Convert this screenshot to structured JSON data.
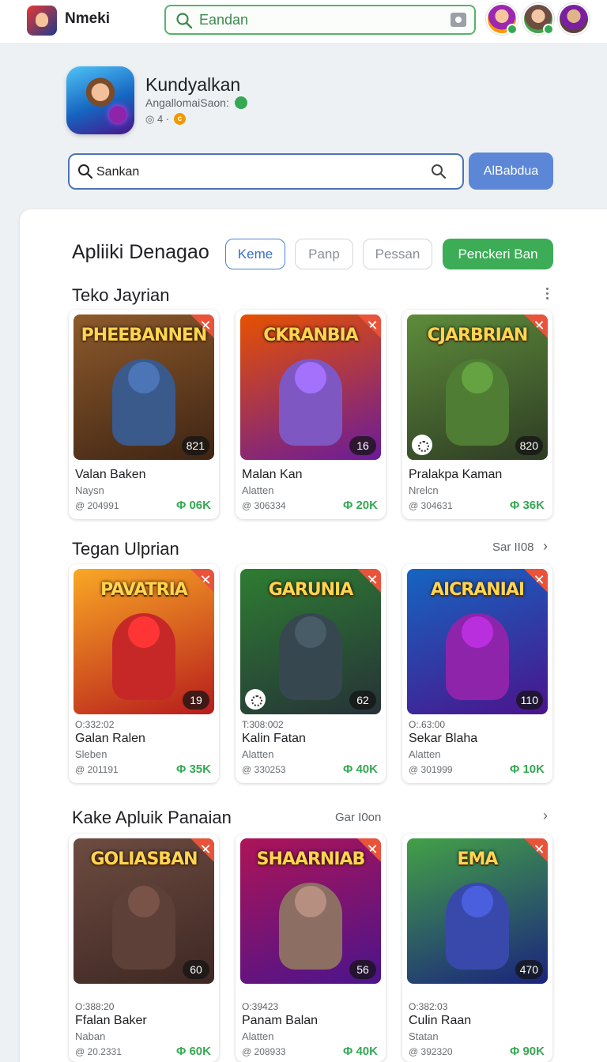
{
  "topbar": {
    "brand": "Nmeki",
    "search_value": "Eandan"
  },
  "app": {
    "name": "Kundyalkan",
    "developer": "AngallomaiSaon:",
    "meta": "4 ·"
  },
  "search": {
    "value": "Sankan",
    "button_label": "AlBabdua"
  },
  "main": {
    "title": "Apliiki Denagao",
    "chips": [
      "Keme",
      "Panp",
      "Pessan",
      "Penckeri Ban"
    ]
  },
  "sections": [
    {
      "title": "Teko Jayrian",
      "link": "",
      "cards": [
        {
          "art": "PHEEBANNEN",
          "name": "Valan Baken",
          "dev": "Naysn",
          "id": "@ 204991",
          "price": "06K",
          "count": "821",
          "ts": ""
        },
        {
          "art": "CKRANBIA",
          "name": "Malan Kan",
          "dev": "Alatten",
          "id": "@ 306334",
          "price": "20K",
          "count": "16",
          "ts": ""
        },
        {
          "art": "CJARBRIAN",
          "name": "Pralakpa Kaman",
          "dev": "Nrelcn",
          "id": "@ 304631",
          "price": "36K",
          "count": "820",
          "ts": ""
        }
      ]
    },
    {
      "title": "Tegan Ulprian",
      "link": "Sar II08",
      "cards": [
        {
          "art": "PAVATRIA",
          "name": "Galan Ralen",
          "dev": "Sleben",
          "id": "@ 201191",
          "price": "35K",
          "count": "19",
          "ts": "O:332:02"
        },
        {
          "art": "GARUNIA",
          "name": "Kalin Fatan",
          "dev": "Alatten",
          "id": "@ 330253",
          "price": "40K",
          "count": "62",
          "ts": "T:308:002"
        },
        {
          "art": "AICRANIAI",
          "name": "Sekar Blaha",
          "dev": "Alatten",
          "id": "@ 301999",
          "price": "10K",
          "count": "110",
          "ts": "O:.63:00"
        }
      ]
    },
    {
      "title": "Kake Apluik Panaian",
      "link": "Gar I0on",
      "cards": [
        {
          "art": "GOLIASBAN",
          "name": "Ffalan Baker",
          "dev": "Naban",
          "id": "@ 20.2331",
          "price": "60K",
          "count": "60",
          "ts": "O:388:20"
        },
        {
          "art": "SHAARNIAB",
          "name": "Panam Balan",
          "dev": "Alatten",
          "id": "@ 208933",
          "price": "40K",
          "count": "56",
          "ts": "O:39423"
        },
        {
          "art": "EMA",
          "name": "Culin Raan",
          "dev": "Statan",
          "id": "@ 392320",
          "price": "90K",
          "count": "470",
          "ts": "O:382:03"
        }
      ]
    }
  ],
  "colors": {
    "accent_green": "#3cad56",
    "accent_blue": "#5c87d6",
    "badge_red": "#e8533a"
  },
  "icons": [
    "search-icon",
    "camera-icon",
    "verified-icon",
    "coin-icon",
    "close-icon",
    "more-icon",
    "chevron-right-icon",
    "loading-icon"
  ]
}
